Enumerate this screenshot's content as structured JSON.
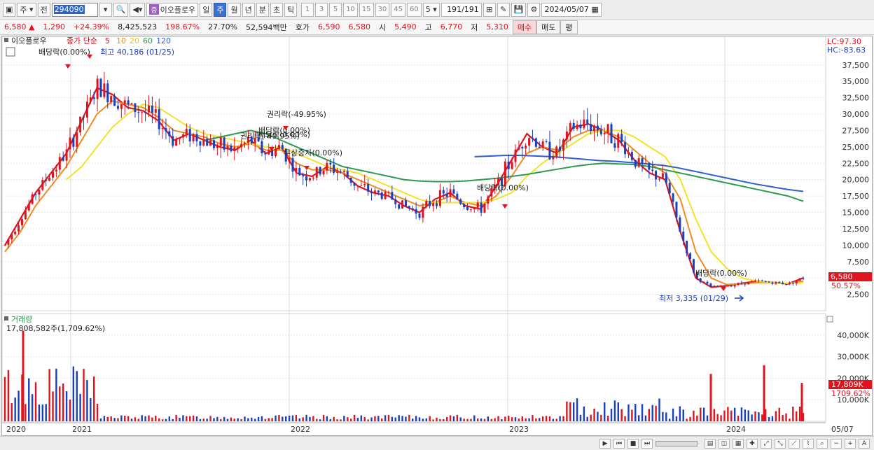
{
  "toolbar": {
    "period_dropdown": "주",
    "jeon_label": "전",
    "stock_code": "294090",
    "tag": "증",
    "stock_name": "이오플로우",
    "period_buttons": [
      "일",
      "주",
      "월",
      "년",
      "분",
      "초",
      "틱"
    ],
    "active_period": "주",
    "num_buttons": [
      "1",
      "3",
      "5",
      "10",
      "15",
      "30",
      "45",
      "60"
    ],
    "count_value": "5",
    "page_current": "191",
    "page_total": "/191",
    "date": "2024/05/07"
  },
  "quote": {
    "price": "6,580",
    "arrow": "▲",
    "change": "1,290",
    "change_pct": "+24.39%",
    "volume": "8,425,523",
    "volume_ratio": "198.67%",
    "turnover": "27.70%",
    "amount": "52,594백만",
    "hoga_label": "호가",
    "ask": "6,590",
    "bid": "6,580",
    "open_label": "시",
    "open": "5,490",
    "high_label": "고",
    "high": "6,770",
    "low_label": "저",
    "low": "5,310",
    "buy_btn": "매수",
    "sell_btn": "매도",
    "eval_btn": "평"
  },
  "price_panel": {
    "name_label": "이오플로우",
    "legend_prefix": "종가 단순",
    "legend_periods": [
      "5",
      "10",
      "20",
      "60",
      "120"
    ],
    "lc": "LC:97.30",
    "hc": "HC:-83.63",
    "current_price_tag": "6,580",
    "current_pct_tag": "50.57%",
    "annotations": [
      {
        "text": "배당락(0.00%)",
        "date": "2021-01"
      },
      {
        "text": "최고 40,186 (01/25)",
        "date": "2021-01"
      },
      {
        "text": "권리락(-49.95%)",
        "date": "2022-01"
      },
      {
        "text": "배당락(0.00%)",
        "date": "2022-01"
      },
      {
        "text": "권리락(-49.95%)",
        "date": "2022-01"
      },
      {
        "text": "배당락(0.00%)",
        "date": "2022-01"
      },
      {
        "text": "무상증자(0.00%)",
        "date": "2022-01"
      },
      {
        "text": "배당락(0.00%)",
        "date": "2023-01"
      },
      {
        "text": "배당락(0.00%)",
        "date": "2023-12"
      },
      {
        "text": "최저 3,335 (01/29)",
        "date": "2024-01"
      }
    ]
  },
  "volume_panel": {
    "title": "거래량",
    "value_label": "17,808,582주(1,709.62%)",
    "current_tag": "17,809K",
    "current_pct": "1709.62%"
  },
  "x_axis": {
    "labels": [
      "2020",
      "2021",
      "2022",
      "2023",
      "2024",
      "05/07"
    ]
  },
  "colors": {
    "up": "#e0141e",
    "down": "#1a3fbf",
    "ma5": "#e0141e",
    "ma10": "#f08c1e",
    "ma20": "#f2e22a",
    "ma60": "#2e9a50",
    "ma120": "#2f5fd0"
  },
  "chart_data": {
    "type": "candlestick",
    "period": "weekly",
    "price_axis": {
      "ticks": [
        2500,
        5000,
        7500,
        10000,
        12500,
        15000,
        17500,
        20000,
        22500,
        25000,
        27500,
        30000,
        32500,
        35000,
        37500
      ],
      "labels": [
        "2,500",
        "5,000",
        "7,500",
        "10,000",
        "12,500",
        "15,000",
        "17,500",
        "20,000",
        "22,500",
        "25,000",
        "27,500",
        "30,000",
        "32,500",
        "35,000",
        "37,500"
      ],
      "ylim": [
        0,
        41000
      ]
    },
    "volume_axis": {
      "ticks": [
        10000,
        20000,
        30000,
        40000
      ],
      "labels": [
        "10,000K",
        "20,000K",
        "30,000K",
        "40,000K"
      ],
      "ylim": [
        0,
        50000
      ]
    },
    "series": [
      {
        "name": "5",
        "values": [
          10000,
          14000,
          18000,
          21000,
          24000,
          29000,
          34000,
          33000,
          31000,
          30500,
          29000,
          26000,
          27000,
          26000,
          25000,
          24500,
          26000,
          24000,
          25000,
          21000,
          20500,
          22000,
          21000,
          19000,
          18000,
          17500,
          16000,
          15000,
          17000,
          18000,
          16000,
          15500,
          19000,
          23000,
          27000,
          25000,
          24000,
          28000,
          28500,
          27500,
          26000,
          23000,
          21000,
          20000,
          12000,
          5000,
          3600,
          3800,
          4200,
          4500,
          4300,
          4100,
          5000
        ]
      },
      {
        "name": "10",
        "values": [
          9000,
          12000,
          16000,
          19000,
          22000,
          26000,
          30000,
          32000,
          31500,
          31000,
          29500,
          27500,
          27000,
          26500,
          25500,
          25000,
          25500,
          24500,
          24500,
          22500,
          21500,
          21500,
          21000,
          20000,
          19000,
          18000,
          17000,
          16000,
          16500,
          17500,
          16500,
          16000,
          17500,
          20500,
          24000,
          25000,
          24500,
          26500,
          27500,
          27500,
          26500,
          24500,
          22500,
          21000,
          17000,
          9000,
          5000,
          4000,
          4100,
          4300,
          4300,
          4200,
          4500
        ]
      },
      {
        "name": "20",
        "values": [
          null,
          null,
          null,
          null,
          20000,
          22000,
          25000,
          28000,
          30000,
          31500,
          31000,
          29500,
          28000,
          27000,
          26500,
          26000,
          25500,
          25000,
          25000,
          24000,
          23000,
          22000,
          21500,
          21000,
          20000,
          19000,
          18000,
          17000,
          16500,
          16500,
          16500,
          16500,
          17000,
          18000,
          20500,
          22500,
          24000,
          25500,
          27000,
          27500,
          27500,
          26500,
          25000,
          23500,
          20000,
          14000,
          9000,
          6500,
          5000,
          4500,
          4300,
          4200,
          4300
        ]
      },
      {
        "name": "60",
        "values": [
          null,
          null,
          null,
          null,
          null,
          null,
          null,
          null,
          null,
          null,
          null,
          null,
          null,
          26000,
          26500,
          27000,
          27500,
          27000,
          26000,
          25000,
          24000,
          23000,
          22000,
          21500,
          21000,
          20500,
          20000,
          19800,
          19700,
          19700,
          19800,
          20000,
          20200,
          20500,
          20800,
          21200,
          21600,
          22000,
          22300,
          22500,
          22400,
          22300,
          22000,
          21500,
          21000,
          20500,
          20000,
          19500,
          19000,
          18500,
          18000,
          17500,
          16700
        ]
      },
      {
        "name": "120",
        "values": [
          null,
          null,
          null,
          null,
          null,
          null,
          null,
          null,
          null,
          null,
          null,
          null,
          null,
          null,
          null,
          null,
          null,
          null,
          null,
          null,
          null,
          null,
          null,
          null,
          null,
          null,
          null,
          null,
          null,
          null,
          23500,
          23600,
          23700,
          23700,
          23600,
          23500,
          23300,
          23100,
          22900,
          22800,
          22600,
          22400,
          22200,
          21800,
          21300,
          20800,
          20300,
          19800,
          19300,
          18900,
          18500,
          18200
        ]
      }
    ],
    "volume_highlights": [
      {
        "date": "2020-03",
        "value": 42000
      },
      {
        "date": "2023-12",
        "value": 22000
      },
      {
        "date": "2024-03",
        "value": 26000
      },
      {
        "date": "2024-05-07",
        "value": 17809
      }
    ]
  }
}
